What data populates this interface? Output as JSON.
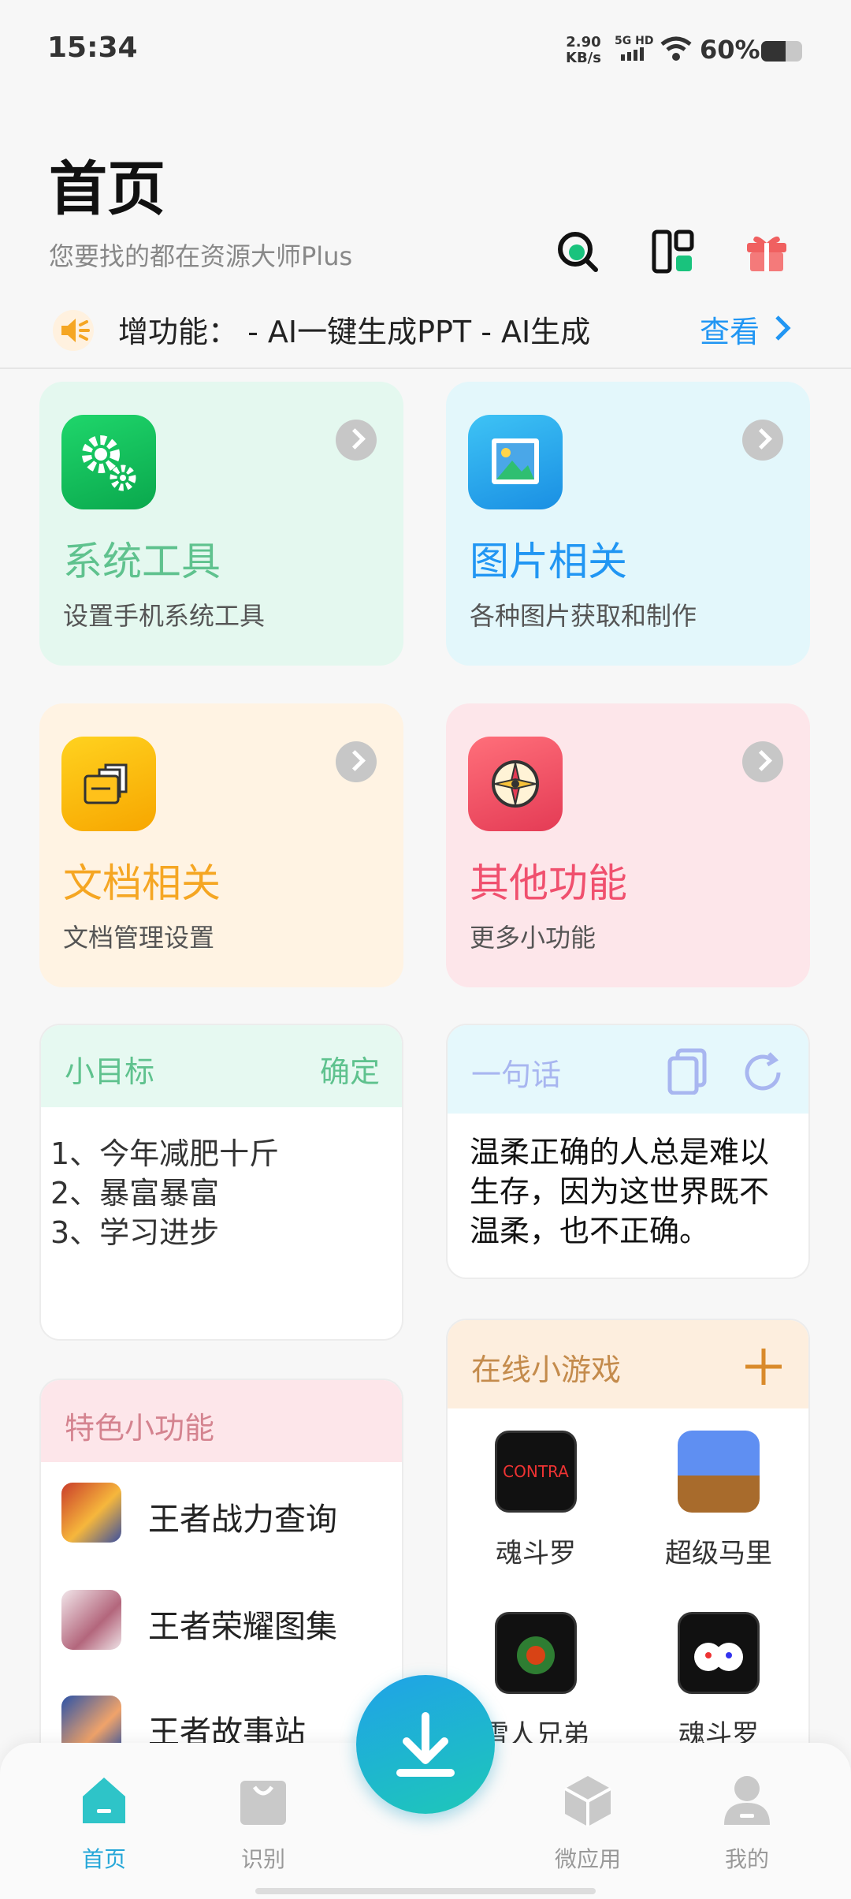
{
  "status": {
    "time": "15:34",
    "net_speed": "2.90",
    "net_unit": "KB/s",
    "signal_label": "5G HD",
    "battery": "60%"
  },
  "header": {
    "title": "首页",
    "subtitle": "您要找的都在资源大师Plus",
    "icons": [
      "search-icon",
      "layout-icon",
      "gift-icon"
    ]
  },
  "notice": {
    "text": "增功能：    - AI一键生成PPT - AI生成",
    "more_label": "查看"
  },
  "categories": [
    {
      "name": "系统工具",
      "desc": "设置手机系统工具",
      "color": "#5fc28e",
      "bg": "#e4f8ef",
      "icon": "gear-icon"
    },
    {
      "name": "图片相关",
      "desc": "各种图片获取和制作",
      "color": "#2196f3",
      "bg": "#e3f7fb",
      "icon": "picture-icon"
    },
    {
      "name": "文档相关",
      "desc": "文档管理设置",
      "color": "#f5a623",
      "bg": "#fff3e3",
      "icon": "folder-icon"
    },
    {
      "name": "其他功能",
      "desc": "更多小功能",
      "color": "#f0506e",
      "bg": "#fde6ea",
      "icon": "compass-icon"
    }
  ],
  "goals": {
    "title": "小目标",
    "confirm": "确定",
    "items": [
      "1、今年减肥十斤",
      "2、暴富暴富",
      "3、学习进步"
    ]
  },
  "quote": {
    "title": "一句话",
    "text": "温柔正确的人总是难以生存，因为这世界既不温柔，也不正确。"
  },
  "features": {
    "title": "特色小功能",
    "items": [
      "王者战力查询",
      "王者荣耀图集",
      "王者故事站"
    ]
  },
  "games": {
    "title": "在线小游戏",
    "items": [
      "魂斗罗",
      "超级马里",
      "雪人兄弟",
      "魂斗罗"
    ]
  },
  "nav": {
    "items": [
      "首页",
      "识别",
      "微应用",
      "我的"
    ],
    "active": "首页"
  }
}
